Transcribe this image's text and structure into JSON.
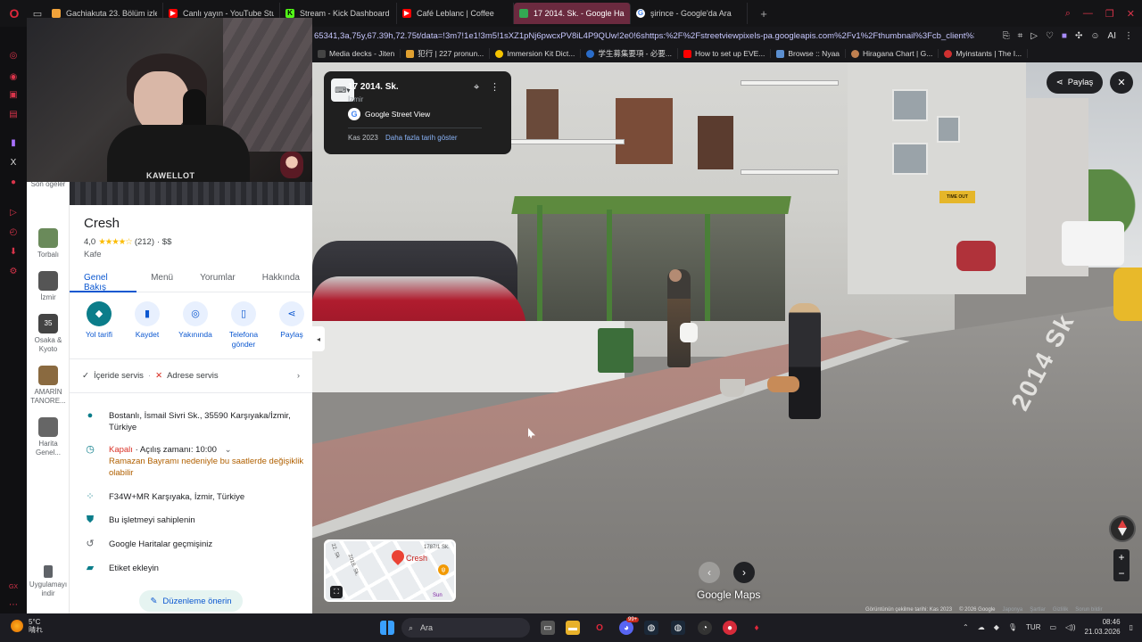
{
  "browser": {
    "tabs": [
      {
        "title": "Gachiakuta 23. Bölüm izle",
        "icon": "anime-site-icon",
        "color": "#f2a33a",
        "active": false
      },
      {
        "title": "Canlı yayın - YouTube Stud",
        "icon": "youtube-icon",
        "color": "#ff0000",
        "active": false
      },
      {
        "title": "Stream - Kick Dashboard",
        "icon": "kick-icon",
        "color": "#53fc18",
        "active": false
      },
      {
        "title": "Café Leblanc | Coffee",
        "icon": "youtube-icon",
        "color": "#ff0000",
        "active": false
      },
      {
        "title": "17 2014. Sk. - Google Har",
        "icon": "google-maps-icon",
        "color": "#34a853",
        "active": true
      },
      {
        "title": "şirince - Google'da Ara",
        "icon": "google-icon",
        "color": "#4285f4",
        "active": false
      }
    ],
    "new_tab": "+",
    "url": "65341,3a,75y,67.39h,72.75t/data=!3m7!1e1!3m5!1sXZ1pNj6pwcxPV8iL4P9QUw!2e0!6shttps:%2F%2Fstreetviewpixels-pa.googleapis.com%2Fv1%2Fthumbnail%3Fcb_client%3Dma",
    "toolbar_ai": "AI",
    "bookmarks": [
      {
        "label": "Media decks - Jiten",
        "color": "#333"
      },
      {
        "label": "犯行 | 227 pronun...",
        "color": "#e0a030"
      },
      {
        "label": "Immersion Kit Dict...",
        "color": "#f5c400"
      },
      {
        "label": "学生募集要項 - 必要...",
        "color": "#2a6cc9"
      },
      {
        "label": "How to set up EVE...",
        "color": "#ff0000"
      },
      {
        "label": "Browse :: Nyaa",
        "color": "#5b8fd0"
      },
      {
        "label": "Hiragana Chart | G...",
        "color": "#c08050"
      },
      {
        "label": "Myinstants | The I...",
        "color": "#d03030"
      }
    ]
  },
  "webcam": {
    "streamer_name": "KAWELLOT"
  },
  "maps_strip": {
    "top_label": "Son öğeler",
    "items": [
      {
        "label": "Torbalı",
        "color": "#6a8a5a"
      },
      {
        "label": "İzmir",
        "color": "#555"
      },
      {
        "label": "Osaka & Kyoto",
        "color": "#444",
        "badge": "35"
      },
      {
        "label": "AMARİN TANORE...",
        "color": "#8a6a40"
      },
      {
        "label": "Harita Genel...",
        "color": "#666"
      }
    ],
    "bottom_label": "Uygulamayı indir"
  },
  "place": {
    "name": "Cresh",
    "rating": "4,0",
    "stars": "★★★★☆",
    "review_count": "(212)",
    "price": "· $$",
    "category": "Kafe",
    "tabs": [
      "Genel Bakış",
      "Menü",
      "Yorumlar",
      "Hakkında"
    ],
    "actions": [
      {
        "label": "Yol tarifi",
        "icon": "directions-icon"
      },
      {
        "label": "Kaydet",
        "icon": "bookmark-icon"
      },
      {
        "label": "Yakınında",
        "icon": "nearby-icon"
      },
      {
        "label": "Telefona gönder",
        "icon": "send-to-phone-icon"
      },
      {
        "label": "Paylaş",
        "icon": "share-icon"
      }
    ],
    "services": {
      "dine_in": "İçeride servis",
      "delivery": "Adrese servis"
    },
    "address": "Bostanlı, İsmail Sivri Sk., 35590 Karşıyaka/İzmir, Türkiye",
    "hours_status": "Kapalı",
    "hours_open": "· Açılış zamanı: 10:00",
    "hours_note": "Ramazan Bayramı nedeniyle bu saatlerde değişiklik olabilir",
    "plus_code": "F34W+MR Karşıyaka, İzmir, Türkiye",
    "claim": "Bu işletmeyi sahiplenin",
    "history": "Google Haritalar geçmişiniz",
    "label": "Etiket ekleyin",
    "suggest_edit": "Düzenleme önerin"
  },
  "street_view": {
    "street": "17 2014. Sk.",
    "city": "İzmir",
    "provider": "Google Street View",
    "date": "Kas 2023",
    "more_dates": "Daha fazla tarih göster",
    "share": "Paylaş",
    "road_marking": "2014 Sk",
    "shop_sign": "TIME OUT",
    "minimap": {
      "place": "Cresh",
      "street_a": "2018. Sk.",
      "street_b": "22. Sk",
      "street_c": "1787/1 Sk.",
      "poi": "Sun"
    },
    "logo": "Google Maps",
    "footer": {
      "captured": "Görüntünün çekilme tarihi: Kas 2023",
      "copyright": "© 2026 Google",
      "links": [
        "Japonya",
        "Şartlar",
        "Gizlilik",
        "Sorun bildir"
      ]
    }
  },
  "taskbar": {
    "temp": "5°C",
    "weather": "晴れ",
    "search": "Ara",
    "lang": "TUR",
    "time": "08:46",
    "date": "21.03.2026",
    "badge": "99+"
  }
}
